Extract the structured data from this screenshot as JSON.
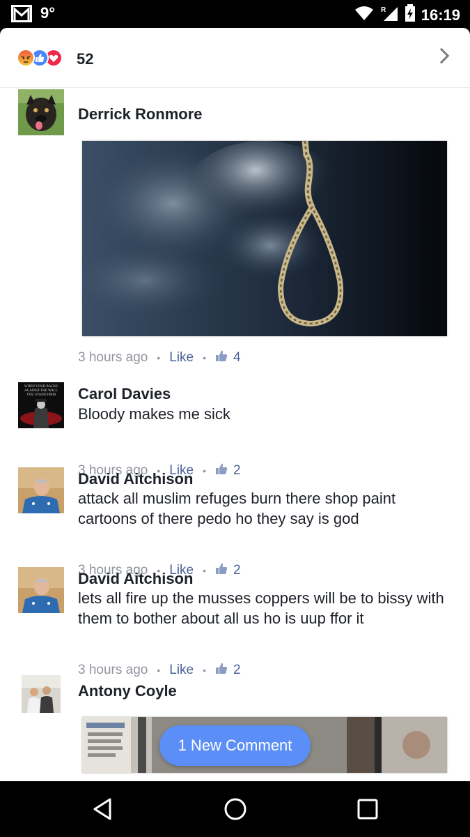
{
  "status_bar": {
    "temperature": "9°",
    "time": "16:19",
    "icons": [
      "gmail-icon",
      "wifi-icon",
      "signal-roaming-icon",
      "battery-charging-icon"
    ]
  },
  "reactions": {
    "types": [
      "angry",
      "like",
      "love"
    ],
    "count": "52"
  },
  "comments": [
    {
      "author": "Derrick Ronmore",
      "text": "",
      "has_photo": true,
      "photo_subject": "noose-photo",
      "time": "3 hours ago",
      "like_label": "Like",
      "likes": "4"
    },
    {
      "author": "Carol Davies",
      "text": "Bloody makes me sick",
      "time": "3 hours ago",
      "like_label": "Like",
      "likes": "2"
    },
    {
      "author": "David Aitchison",
      "text": "attack all muslim refuges burn there shop paint cartoons of there pedo ho they say is god",
      "time": "3 hours ago",
      "like_label": "Like",
      "likes": "2"
    },
    {
      "author": "David Aitchison",
      "text": "lets all fire up the musses coppers will be to bissy with them to bother about all us ho is uup ffor it",
      "time": "3 hours ago",
      "like_label": "Like",
      "likes": "2"
    },
    {
      "author": "Antony Coyle",
      "text": "",
      "has_photo": true
    }
  ],
  "avatar_text": {
    "carol": "WHEN YOUR BACKS AGAINST THE WALL YOU STAND FIRM"
  },
  "new_comment_button": "1 New Comment",
  "colors": {
    "name_text": "#1d2129",
    "meta_grey": "#90949c",
    "link_blue": "#4b6399",
    "new_comment_bg": "#5b8ff7"
  }
}
